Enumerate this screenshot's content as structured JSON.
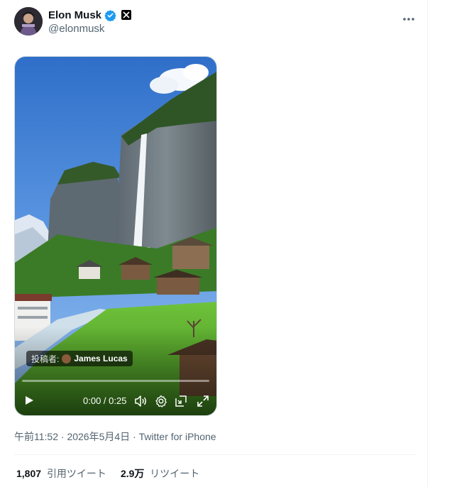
{
  "user": {
    "name": "Elon Musk",
    "handle": "@elonmusk",
    "verified_icon": "verified-badge-icon",
    "affiliation_icon": "x-logo-icon"
  },
  "menu": {
    "icon": "more-icon"
  },
  "media": {
    "credit_prefix": "投稿者:",
    "credit_name": "James Lucas",
    "time": "0:00 / 0:25"
  },
  "meta": {
    "time": "午前11:52",
    "separator": "·",
    "date": "2026年5月4日",
    "source": "Twitter for iPhone"
  },
  "stats": {
    "quotes_count": "1,807",
    "quotes_label": "引用ツイート",
    "retweets_count": "2.9万",
    "retweets_label": "リツイート"
  },
  "colors": {
    "text": "#0f1419",
    "secondary": "#536471",
    "verified": "#1d9bf0"
  }
}
